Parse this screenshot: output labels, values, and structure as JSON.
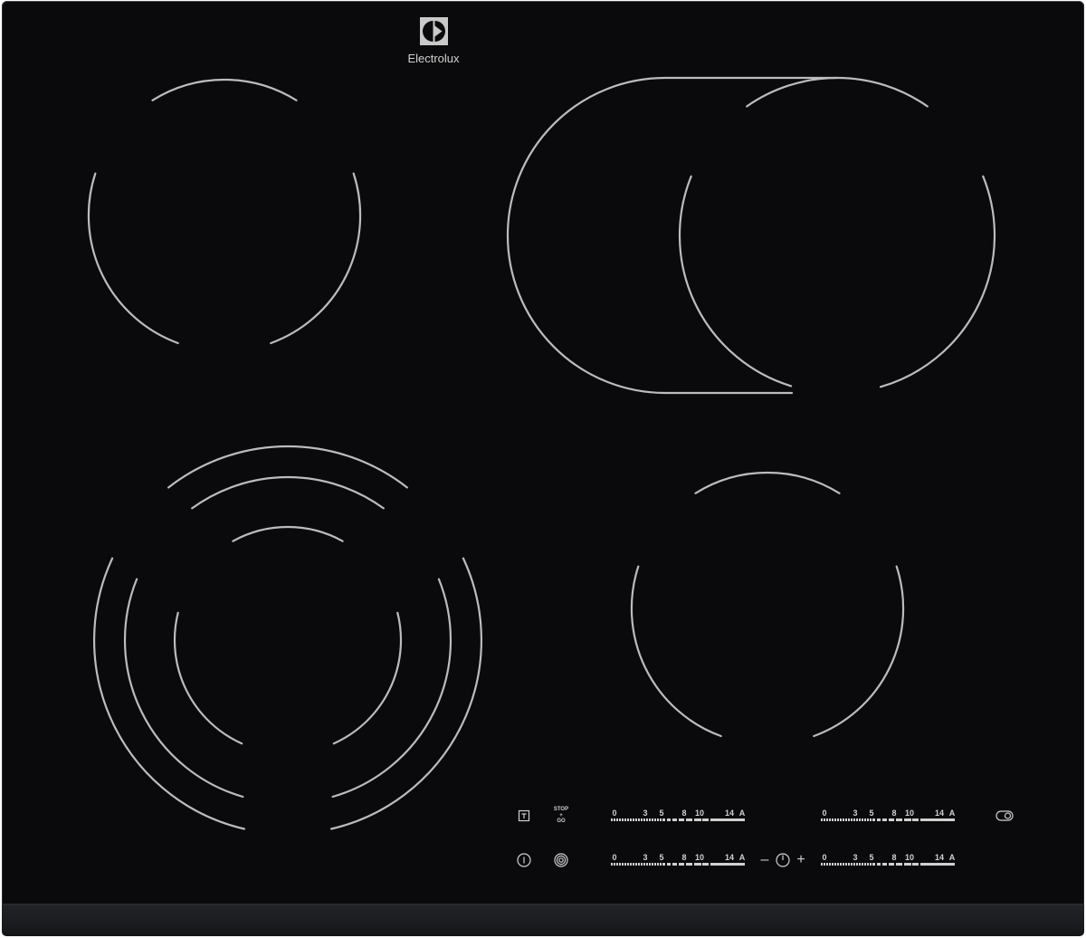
{
  "brand": {
    "name": "Electrolux",
    "logo_icon": "electrolux-logo-icon"
  },
  "colors": {
    "page": "#ffffff",
    "glass": "#0a0a0c",
    "front_edge": "#1c1d20",
    "zone_lines": "#bcbcbc",
    "print": "#d0d0d0"
  },
  "controls": {
    "lock": {
      "icon": "lock-icon"
    },
    "stop_go": {
      "top": "STOP",
      "middle": "+",
      "bottom": "GO"
    },
    "power": {
      "icon": "power-icon"
    },
    "dual_zone": {
      "icon": "dual-zone-icon"
    },
    "bridge": {
      "icon": "bridge-toggle-icon"
    },
    "timer": {
      "minus": "–",
      "icon": "clock-icon",
      "plus": "+"
    },
    "sliders": [
      {
        "scale": [
          "0",
          "3",
          "5",
          "8",
          "10",
          "14",
          "A"
        ]
      },
      {
        "scale": [
          "0",
          "3",
          "5",
          "8",
          "10",
          "14",
          "A"
        ]
      },
      {
        "scale": [
          "0",
          "3",
          "5",
          "8",
          "10",
          "14",
          "A"
        ]
      },
      {
        "scale": [
          "0",
          "3",
          "5",
          "8",
          "10",
          "14",
          "A"
        ]
      }
    ]
  }
}
